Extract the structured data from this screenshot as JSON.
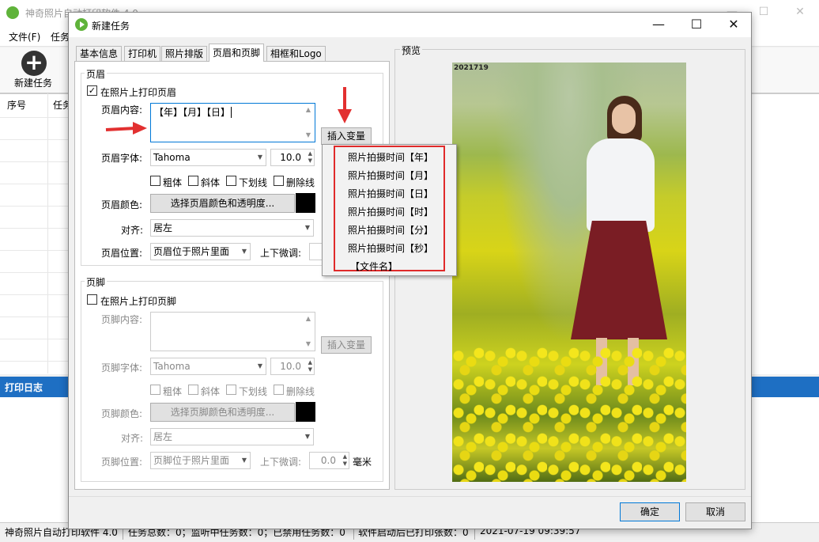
{
  "main": {
    "title": "神奇照片自动打印软件 4.0",
    "menu": [
      "文件(F)",
      "任务"
    ],
    "toolbar_new_task": "新建任务",
    "table_headers": [
      "序号",
      "任务"
    ],
    "log_title": "打印日志",
    "status": {
      "app": "神奇照片自动打印软件 4.0",
      "counts": "任务总数：0；监听中任务数：0；已禁用任务数：0",
      "printed": "软件启动后已打印张数：0",
      "datetime": "2021-07-19 09:39:57"
    }
  },
  "dialog": {
    "title": "新建任务",
    "tabs": [
      "基本信息",
      "打印机",
      "照片排版",
      "页眉和页脚",
      "相框和Logo"
    ],
    "active_tab": 3,
    "header": {
      "group": "页眉",
      "print_checkbox": "在照片上打印页眉",
      "checked": true,
      "content_label": "页眉内容:",
      "content_value": "【年】【月】【日】",
      "insert_var": "插入变量",
      "font_label": "页眉字体:",
      "font_value": "Tahoma",
      "size_value": "10.0",
      "styles": [
        "粗体",
        "斜体",
        "下划线",
        "删除线"
      ],
      "color_label": "页眉颜色:",
      "color_button": "选择页眉颜色和透明度...",
      "align_label": "对齐:",
      "align_value": "居左",
      "position_label": "页眉位置:",
      "position_value": "页眉位于照片里面",
      "offset_label": "上下微调:"
    },
    "footer": {
      "group": "页脚",
      "print_checkbox": "在照片上打印页脚",
      "checked": false,
      "content_label": "页脚内容:",
      "content_value": "",
      "insert_var": "插入变量",
      "font_label": "页脚字体:",
      "font_value": "Tahoma",
      "size_value": "10.0",
      "styles": [
        "粗体",
        "斜体",
        "下划线",
        "删除线"
      ],
      "color_label": "页脚颜色:",
      "color_button": "选择页脚颜色和透明度...",
      "align_label": "对齐:",
      "align_value": "居左",
      "position_label": "页脚位置:",
      "position_value": "页脚位于照片里面",
      "offset_label": "上下微调:",
      "offset_value": "0.0",
      "offset_unit": "毫米"
    },
    "variable_menu": [
      "照片拍摄时间【年】",
      "照片拍摄时间【月】",
      "照片拍摄时间【日】",
      "照片拍摄时间【时】",
      "照片拍摄时间【分】",
      "照片拍摄时间【秒】",
      "【文件名】"
    ],
    "preview": {
      "label": "预览",
      "photo_date": "2021719"
    },
    "ok": "确定",
    "cancel": "取消"
  },
  "colors": {
    "accent_blue": "#1e6fc3",
    "highlight_red": "#e02a2a",
    "header_color": "#000000"
  }
}
